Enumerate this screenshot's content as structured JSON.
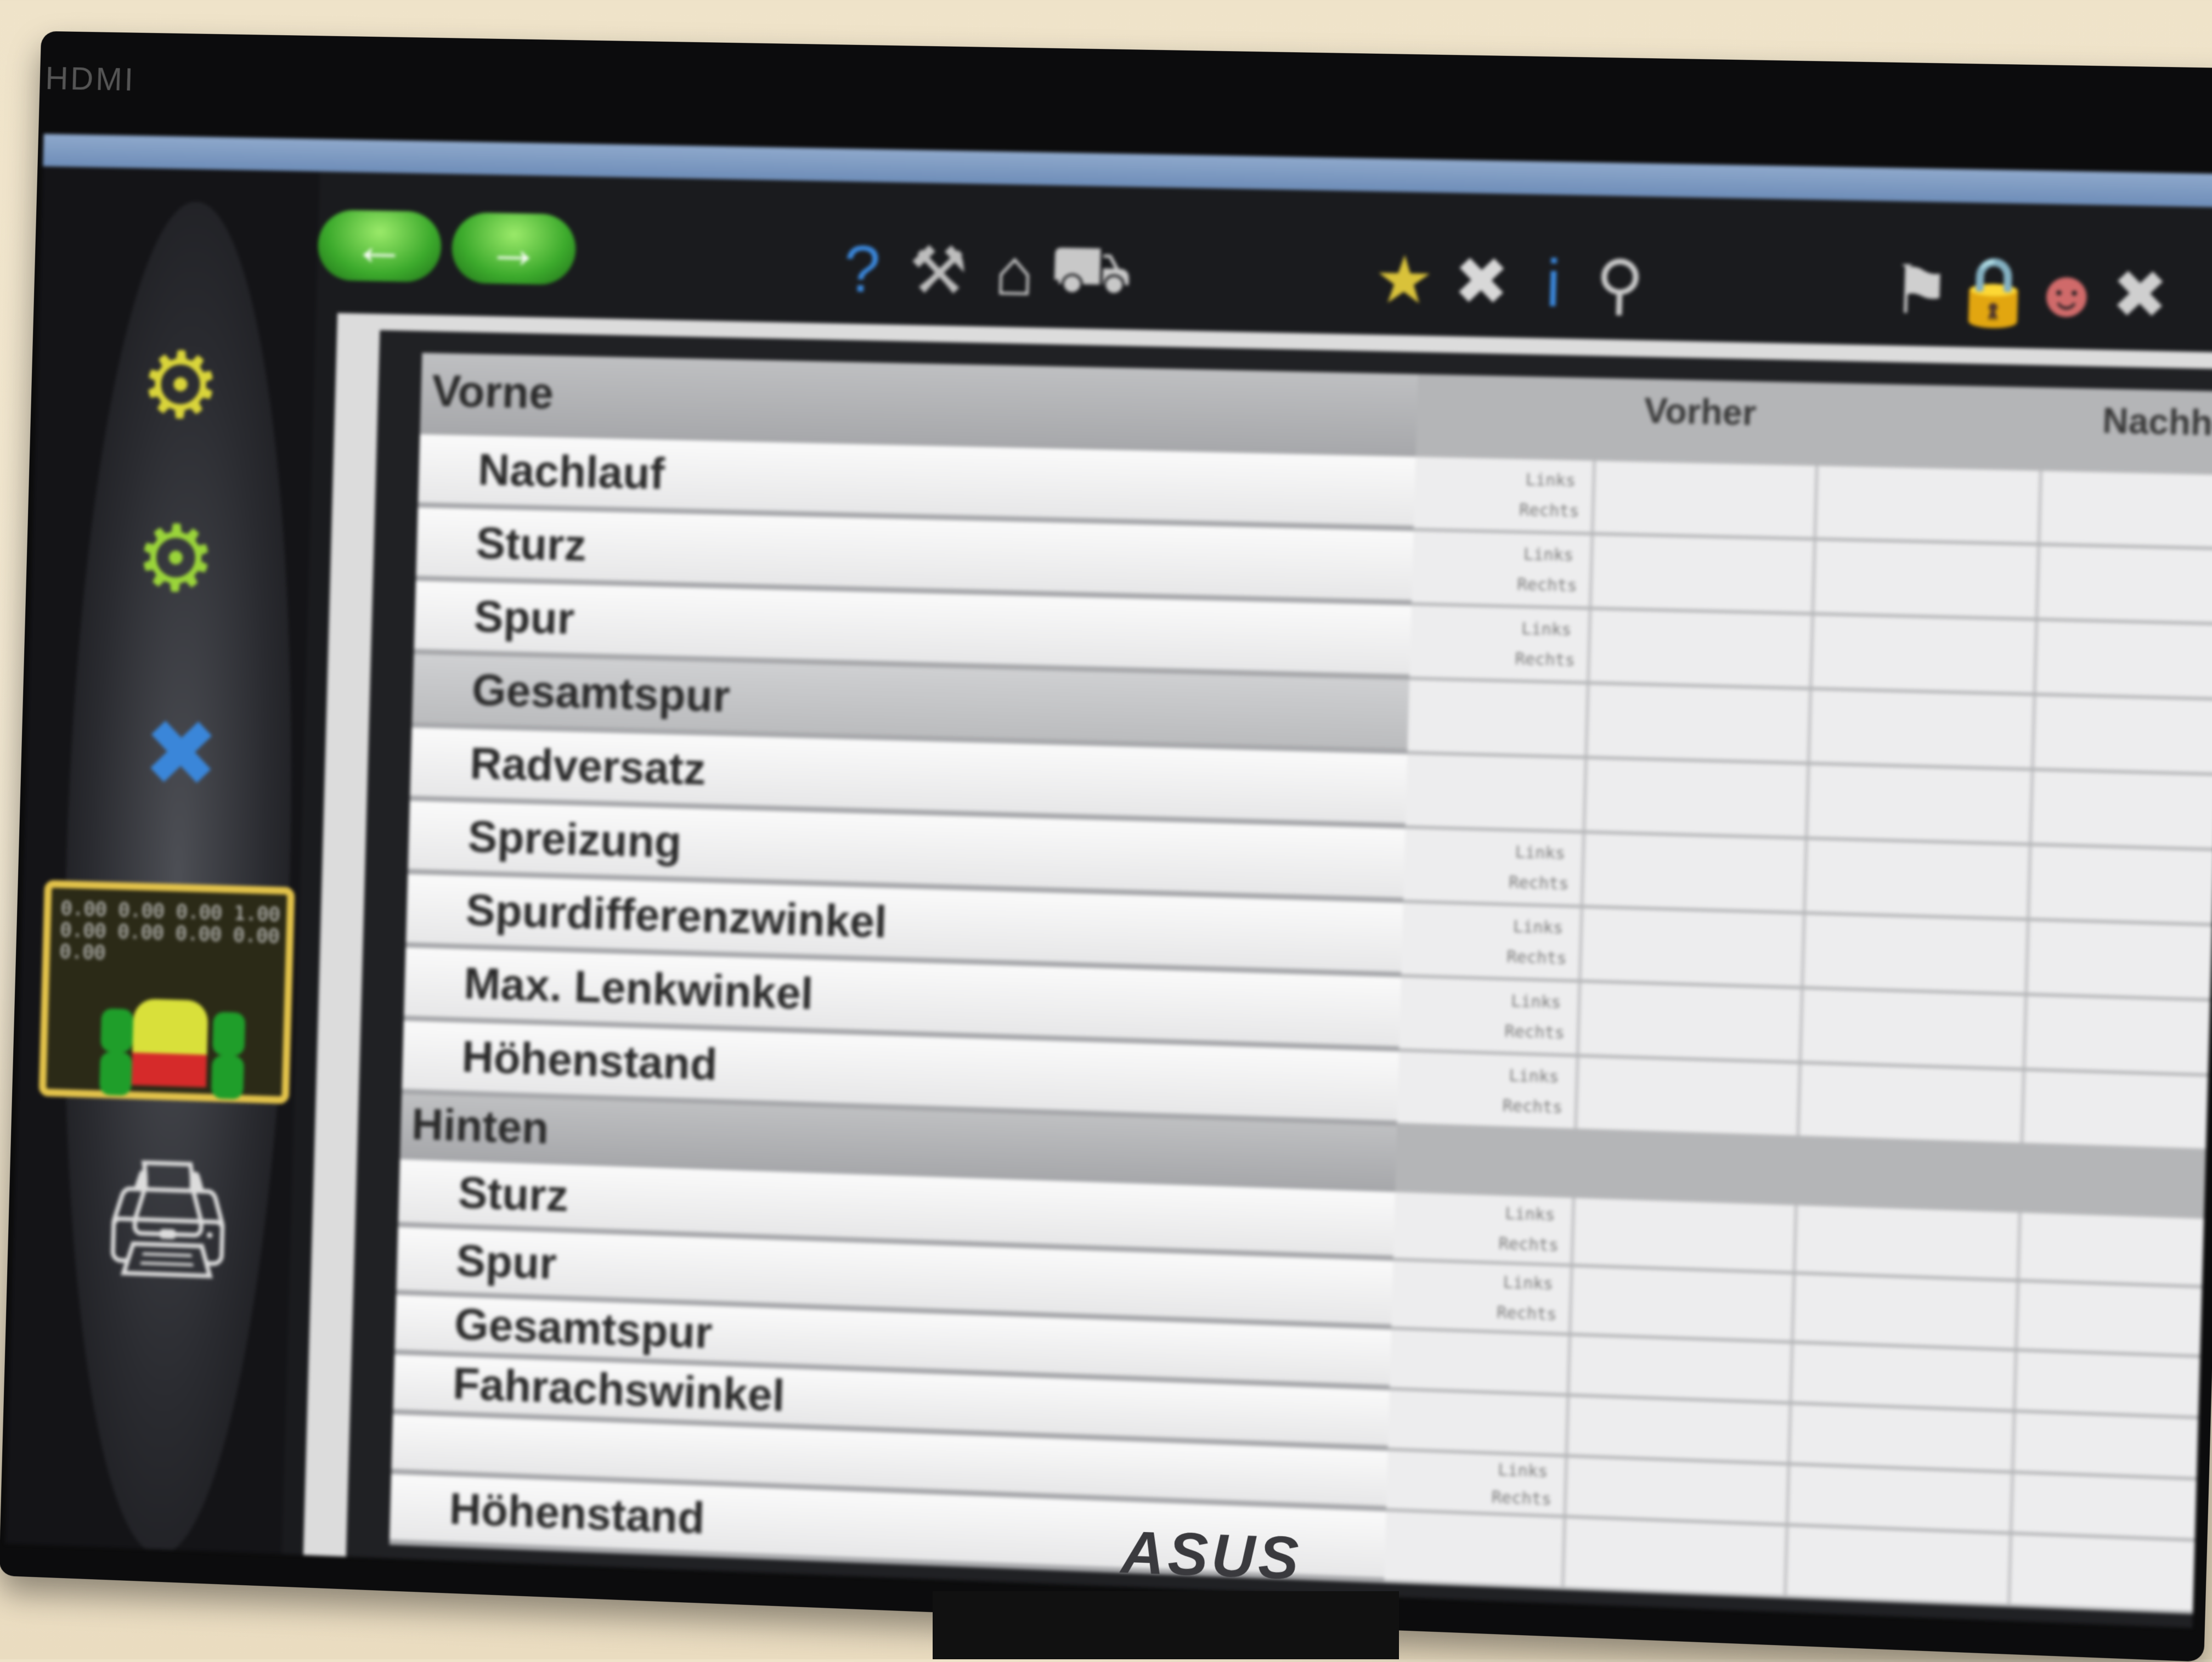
{
  "monitor": {
    "bezel_label": "HDMI",
    "brand": "ASUS"
  },
  "toolbar": {
    "back_label": "←",
    "forward_label": "→",
    "icons_group1": [
      "help-icon",
      "tools-icon",
      "home-icon",
      "car-icon"
    ],
    "icons_group2": [
      "vehicle-icon",
      "settings-icon",
      "info-icon",
      "zoom-icon"
    ],
    "icons_group3": [
      "tag-icon",
      "lock-icon",
      "person-icon",
      "exit-icon"
    ]
  },
  "sidebar": {
    "items": [
      {
        "name": "wheel-sensor-icon"
      },
      {
        "name": "wheel-adjust-icon"
      },
      {
        "name": "axle-icon"
      },
      {
        "name": "results-overview-icon",
        "active": true
      },
      {
        "name": "printer-icon"
      }
    ],
    "overview_grid": "0.00 0.00 0.00\n1.00 0.00 0.00\n0.00 0.00 0.00"
  },
  "table": {
    "headers": {
      "vorher": "Vorher",
      "nachher": "Nachher"
    },
    "sections": [
      {
        "title": "Vorne",
        "rows": [
          {
            "label": "Nachlauf"
          },
          {
            "label": "Sturz"
          },
          {
            "label": "Spur"
          },
          {
            "label": "Gesamtspur"
          },
          {
            "label": "Radversatz"
          },
          {
            "label": "Spreizung"
          },
          {
            "label": "Spurdifferenzwinkel"
          },
          {
            "label": "Max. Lenkwinkel"
          },
          {
            "label": "Höhenstand"
          }
        ]
      },
      {
        "title": "Hinten",
        "rows": [
          {
            "label": "Sturz"
          },
          {
            "label": "Spur"
          },
          {
            "label": "Gesamtspur"
          },
          {
            "label": "Fahrachswinkel"
          },
          {
            "label": ""
          },
          {
            "label": "Höhenstand"
          }
        ]
      }
    ],
    "sides": {
      "left": "Links",
      "right": "Rechts"
    },
    "colors": {
      "out_of_tolerance": "#e53232",
      "in_tolerance": "#36b14a"
    }
  }
}
